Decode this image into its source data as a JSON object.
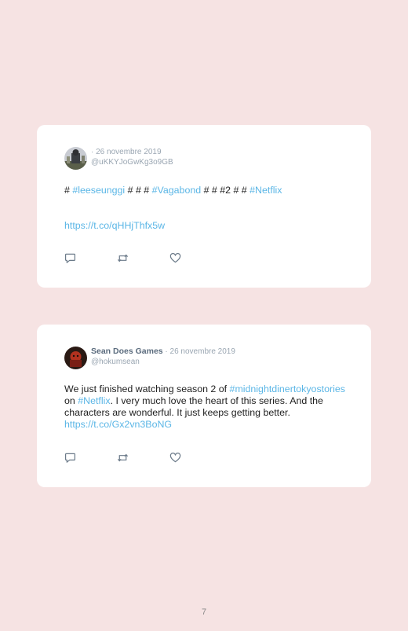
{
  "tweets": [
    {
      "author": "",
      "date": "26 novembre 2019",
      "handle": "@uKKYJoGwKg3o9GB",
      "body": {
        "hash1": "# ",
        "tag1": "#leeseunggi",
        "mid1": " # # # ",
        "tag2": "#Vagabond",
        "mid2": " # # #2 # # ",
        "tag3": "#Netflix",
        "url": "https://t.co/qHHjThfx5w"
      }
    },
    {
      "author": "Sean Does Games",
      "date": "26 novembre 2019",
      "handle": "@hokumsean",
      "body": {
        "text1": "We just finished watching season 2 of ",
        "tag1": "#midnightdinertokyostories",
        "text2": " on ",
        "tag2": "#Netflix",
        "text3": ". I very much love the heart of this series. And the characters are wonderful. It just keeps getting better. ",
        "url": "https://t.co/Gx2vn3BoNG"
      }
    }
  ],
  "actions": [
    "reply-icon",
    "retweet-icon",
    "like-icon"
  ],
  "page_number": "7",
  "colors": {
    "background": "#f6e3e3",
    "card": "#ffffff",
    "link": "#5bb6e6",
    "meta": "#9aa6b2",
    "icon": "#6b7a89"
  }
}
